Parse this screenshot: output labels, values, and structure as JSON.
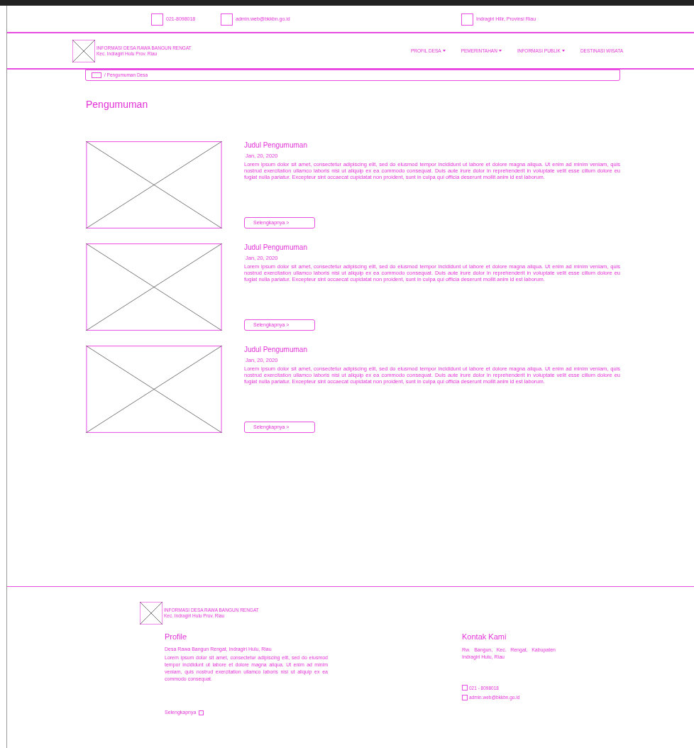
{
  "top_bar": {
    "items": [
      "021-8098018",
      "admin.web@bkkbn.go.id",
      "Indragiri Hilir, Provinsi Riau"
    ]
  },
  "header": {
    "logo_title": "INFORMASI DESA RAWA BANGUN RENGAT",
    "logo_subtitle": "Kec. Indragiri Hulu Prov. Riau",
    "nav": [
      {
        "label": "PROFIL DESA",
        "dropdown": true
      },
      {
        "label": "PEMERINTAHAN",
        "dropdown": true
      },
      {
        "label": "INFORMASI PUBLIK",
        "dropdown": true
      },
      {
        "label": "DESTINASI WISATA",
        "dropdown": false
      }
    ]
  },
  "breadcrumb": "/ Pengumuman Desa",
  "page_title": "Pengumuman",
  "announcements": [
    {
      "title": "Judul Pengumuman",
      "date": "Jan, 20, 2020",
      "body": "Lorem ipsum dolor sit amet, consectetur adipiscing elit, sed do eiusmod tempor incididunt ut labore et dolore magna aliqua. Ut enim ad minim veniam, quis nostrud exercitation ullamco laboris nisi ut aliquip ex ea commodo consequat. Duis aute irure dolor in reprehenderit in voluptate velit esse cillum dolore eu fugiat nulla pariatur. Excepteur sint occaecat cupidatat non proident, sunt in culpa qui officia deserunt mollit anim id est laborum.",
      "button": "Selengkapnya >"
    },
    {
      "title": "Judul Pengumuman",
      "date": "Jan, 20, 2020",
      "body": "Lorem ipsum dolor sit amet, consectetur adipiscing elit, sed do eiusmod tempor incididunt ut labore et dolore magna aliqua. Ut enim ad minim veniam, quis nostrud exercitation ullamco laboris nisi ut aliquip ex ea commodo consequat. Duis aute irure dolor in reprehenderit in voluptate velit esse cillum dolore eu fugiat nulla pariatur. Excepteur sint occaecat cupidatat non proident, sunt in culpa qui officia deserunt mollit anim id est laborum.",
      "button": "Selengkapnya >"
    },
    {
      "title": "Judul Pengumuman",
      "date": "Jan, 20, 2020",
      "body": "Lorem ipsum dolor sit amet, consectetur adipiscing elit, sed do eiusmod tempor incididunt ut labore et dolore magna aliqua. Ut enim ad minim veniam, quis nostrud exercitation ullamco laboris nisi ut aliquip ex ea commodo consequat. Duis aute irure dolor in reprehenderit in voluptate velit esse cillum dolore eu fugiat nulla pariatur. Excepteur sint occaecat cupidatat non proident, sunt in culpa qui officia deserunt mollit anim id est laborum.",
      "button": "Selengkapnya >"
    }
  ],
  "footer": {
    "logo_title": "INFORMASI DESA RAWA BANGUN RENGAT",
    "logo_subtitle": "Kec. Indragiri Hulu Prov. Riau",
    "profile": {
      "heading": "Profile",
      "subtitle": "Desa Rawa Bangun Rengat, Indragiri Hulu, Riau",
      "body": "Lorem ipsum dolor sit amet, consectetur adipiscing elit, sed do eiusmod tempor incididunt ut labore et dolore magna aliqua. Ut enim ad minim veniam, quis nostrud exercitation ullamco laboris nisi ut aliquip ex ea commodo consequat.",
      "link": "Selengkapnya"
    },
    "contact": {
      "heading": "Kontak Kami",
      "address": "Rw. Bangun, Kec. Rengat, Kabupaten Indragiri Hulu, Riau",
      "items": [
        "021 - 8098018",
        "admin.web@bkkbn.go.id"
      ]
    }
  }
}
